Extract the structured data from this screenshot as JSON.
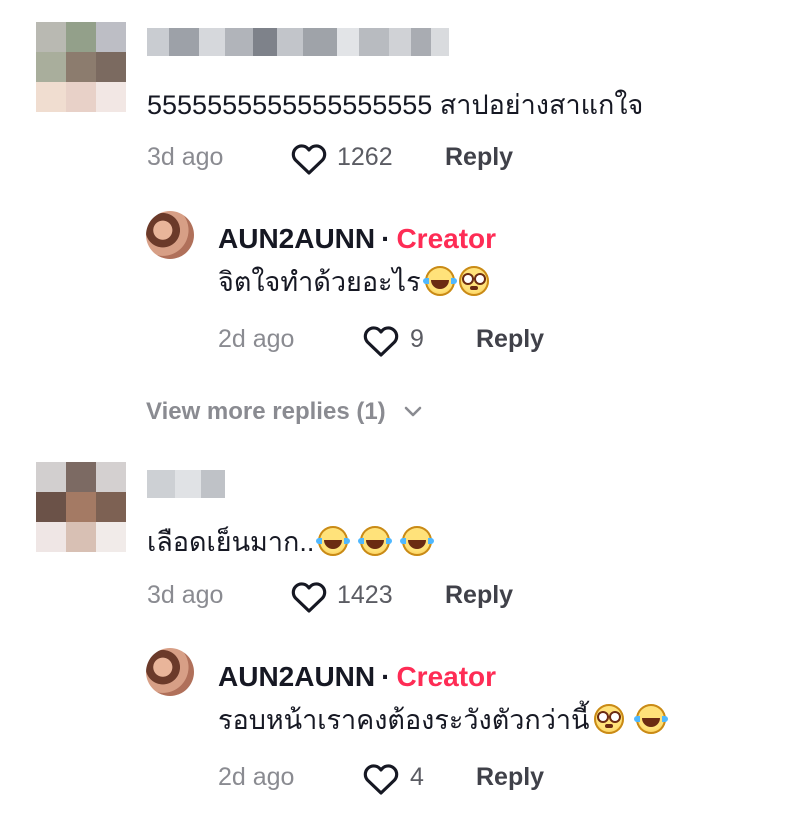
{
  "comments": [
    {
      "text": "5555555555555555555 สาปอย่างสาแกใจ",
      "time": "3d ago",
      "likes": "1262",
      "reply_label": "Reply",
      "reply": {
        "author": "AUN2AUNN",
        "badge": "Creator",
        "separator": "·",
        "text": "จิตใจทำด้วยอะไร",
        "emojis": [
          "grinning-tears-emoji",
          "flushed-face-emoji"
        ],
        "time": "2d ago",
        "likes": "9",
        "reply_label": "Reply"
      },
      "view_more": "View more replies (1)"
    },
    {
      "text": "เลือดเย็นมาก..",
      "emojis": [
        "grinning-tears-emoji",
        "grinning-tears-emoji",
        "grinning-tears-emoji"
      ],
      "time": "3d ago",
      "likes": "1423",
      "reply_label": "Reply",
      "reply": {
        "author": "AUN2AUNN",
        "badge": "Creator",
        "separator": "·",
        "text": "รอบหน้าเราคงต้องระวังตัวกว่านี้",
        "emojis": [
          "flushed-face-emoji",
          "grinning-tears-emoji"
        ],
        "time": "2d ago",
        "likes": "4",
        "reply_label": "Reply"
      }
    }
  ],
  "colors": {
    "creator": "#fe2c55",
    "muted": "#8a8b91",
    "text": "#161823"
  },
  "icons": [
    "heart-icon",
    "chevron-down-icon"
  ]
}
